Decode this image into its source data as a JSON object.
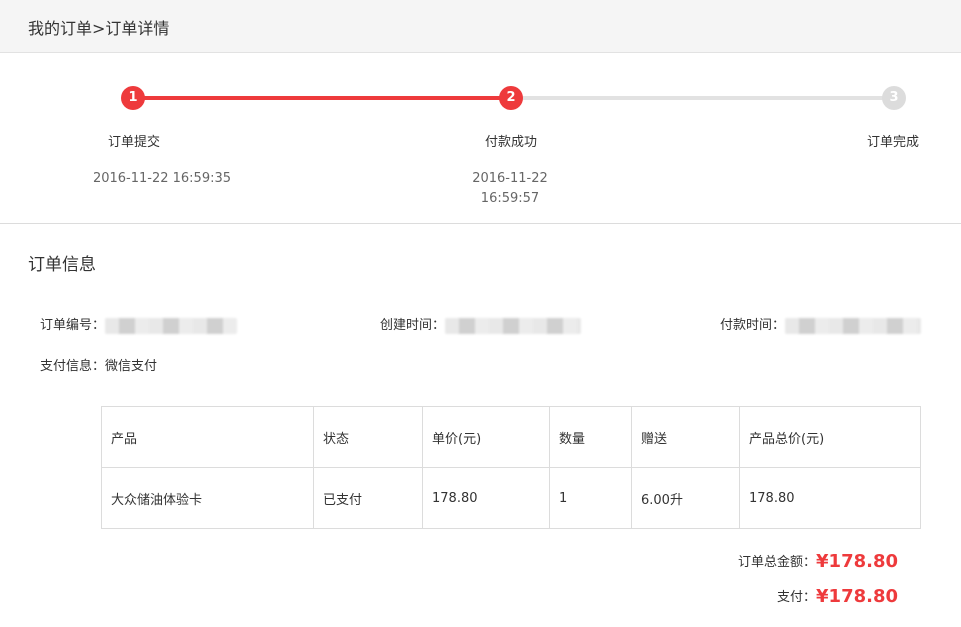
{
  "breadcrumb": {
    "parent": "我的订单",
    "separator": ">",
    "current": "订单详情"
  },
  "progress": {
    "steps": [
      {
        "number": "1",
        "label": "订单提交",
        "time": "2016-11-22 16:59:35",
        "status": "done"
      },
      {
        "number": "2",
        "label": "付款成功",
        "time_date": "2016-11-22",
        "time_clock": "16:59:57",
        "status": "done"
      },
      {
        "number": "3",
        "label": "订单完成",
        "status": "pending"
      }
    ],
    "colors": {
      "active": "#ee3a3c",
      "inactive": "#dcdcdc"
    }
  },
  "order_info": {
    "title": "订单信息",
    "order_no_label": "订单编号：",
    "created_label": "创建时间：",
    "paid_label": "付款时间：",
    "payment_info_label": "支付信息：",
    "payment_info_value": "微信支付"
  },
  "table": {
    "headers": [
      "产品",
      "状态",
      "单价(元)",
      "数量",
      "赠送",
      "产品总价(元)"
    ],
    "rows": [
      [
        "大众储油体验卡",
        "已支付",
        "178.80",
        "1",
        "6.00升",
        "178.80"
      ]
    ]
  },
  "totals": {
    "order_total_label": "订单总金额：",
    "order_total_value": "¥178.80",
    "paid_label": "支付：",
    "paid_value": "¥178.80"
  }
}
